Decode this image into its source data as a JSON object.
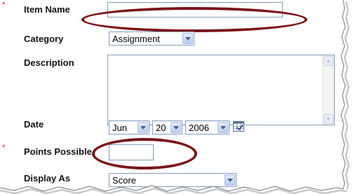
{
  "form": {
    "item_name": {
      "label": "Item Name",
      "required": true,
      "value": ""
    },
    "category": {
      "label": "Category",
      "selected": "Assignment"
    },
    "description": {
      "label": "Description",
      "value": ""
    },
    "date": {
      "label": "Date",
      "month": "Jun",
      "day": "20",
      "year": "2006"
    },
    "points_possible": {
      "label": "Points Possible",
      "required": true,
      "value": ""
    },
    "display_as": {
      "label": "Display As",
      "selected": "Score"
    }
  },
  "required_marker": "*",
  "annotation_color": "#7b1418",
  "icons": {
    "calendar": "calendar-icon",
    "dropdown": "chevron-down-icon"
  }
}
